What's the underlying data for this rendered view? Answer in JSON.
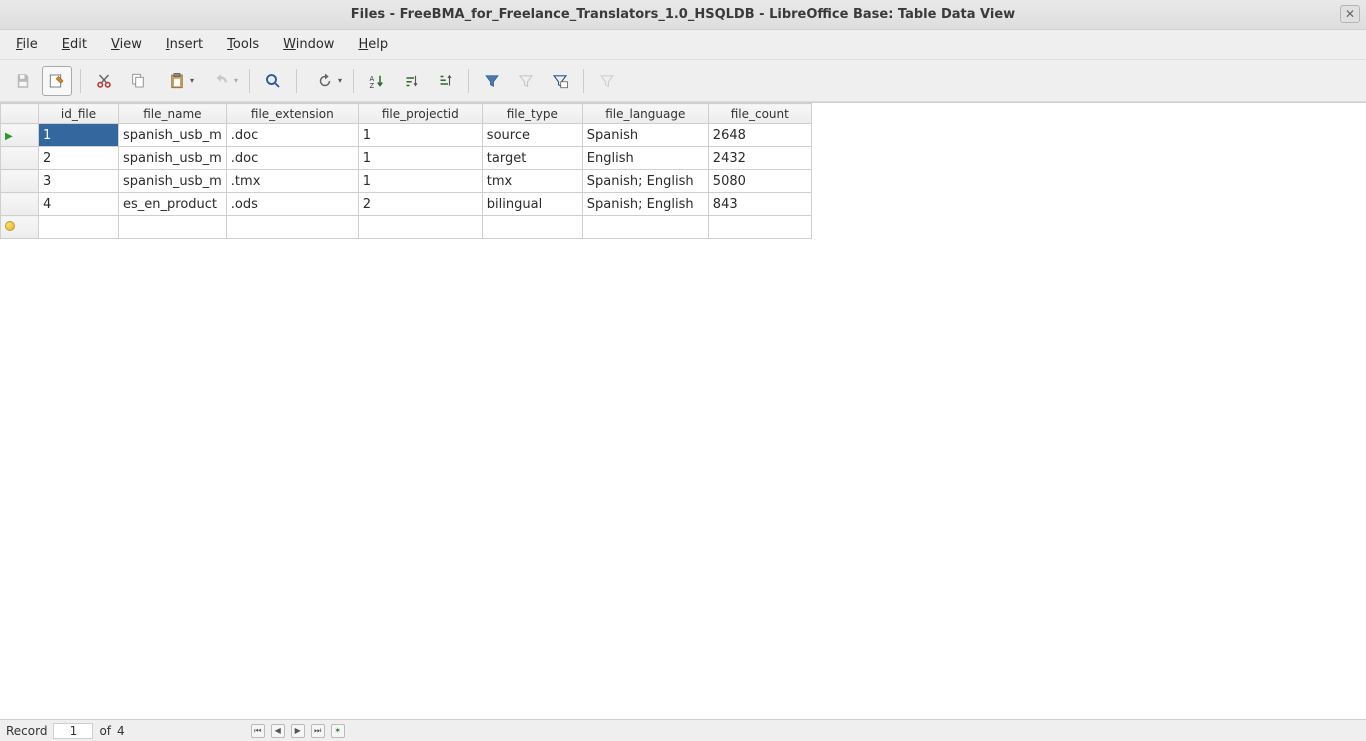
{
  "window": {
    "title": "Files - FreeBMA_for_Freelance_Translators_1.0_HSQLDB - LibreOffice Base: Table Data View"
  },
  "menu": {
    "items": [
      {
        "label": "File",
        "accel": "F"
      },
      {
        "label": "Edit",
        "accel": "E"
      },
      {
        "label": "View",
        "accel": "V"
      },
      {
        "label": "Insert",
        "accel": "I"
      },
      {
        "label": "Tools",
        "accel": "T"
      },
      {
        "label": "Window",
        "accel": "W"
      },
      {
        "label": "Help",
        "accel": "H"
      }
    ]
  },
  "table": {
    "columns": [
      "id_file",
      "file_name",
      "file_extension",
      "file_projectid",
      "file_type",
      "file_language",
      "file_count"
    ],
    "rows": [
      {
        "id_file": "1",
        "file_name": "spanish_usb_m",
        "file_extension": ".doc",
        "file_projectid": "1",
        "file_type": "source",
        "file_language": "Spanish",
        "file_count": "2648"
      },
      {
        "id_file": "2",
        "file_name": "spanish_usb_m",
        "file_extension": ".doc",
        "file_projectid": "1",
        "file_type": "target",
        "file_language": "English",
        "file_count": "2432"
      },
      {
        "id_file": "3",
        "file_name": "spanish_usb_m",
        "file_extension": ".tmx",
        "file_projectid": "1",
        "file_type": "tmx",
        "file_language": "Spanish; English",
        "file_count": "5080"
      },
      {
        "id_file": "4",
        "file_name": "es_en_product",
        "file_extension": ".ods",
        "file_projectid": "2",
        "file_type": "bilingual",
        "file_language": "Spanish; English",
        "file_count": "843"
      }
    ]
  },
  "status": {
    "record_label": "Record",
    "current": "1",
    "of_label": "of",
    "total": "4"
  }
}
